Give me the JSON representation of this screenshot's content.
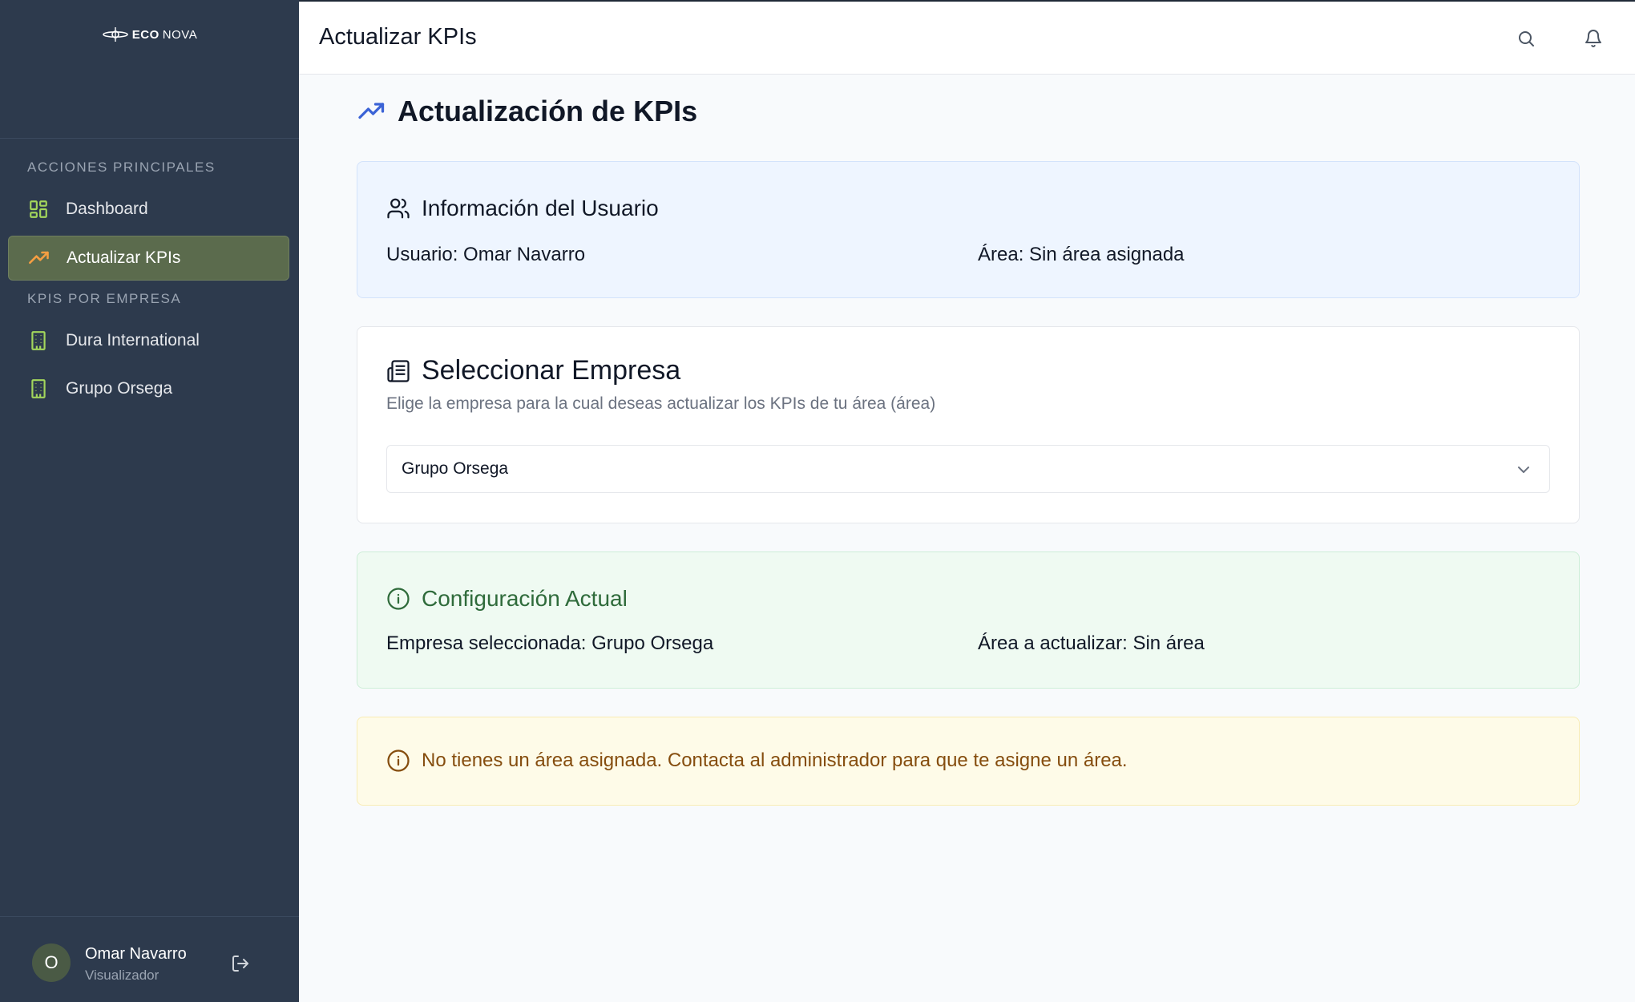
{
  "brand": {
    "logo_eco": "ECO",
    "logo_nova": "NOVA"
  },
  "sidebar": {
    "section_main": "ACCIONES PRINCIPALES",
    "section_kpis": "KPIS POR EMPRESA",
    "items": [
      {
        "label": "Dashboard",
        "icon": "dashboard-grid-icon"
      },
      {
        "label": "Actualizar KPIs",
        "icon": "trending-up-icon",
        "active": true
      },
      {
        "label": "Dura International",
        "icon": "building-icon"
      },
      {
        "label": "Grupo Orsega",
        "icon": "building-icon"
      }
    ],
    "user": {
      "initial": "O",
      "name": "Omar Navarro",
      "role": "Visualizador"
    }
  },
  "header": {
    "title": "Actualizar KPIs"
  },
  "main": {
    "title": "Actualización de KPIs",
    "user_card": {
      "title": "Información del Usuario",
      "user_label": "Usuario:",
      "user_value": "Omar Navarro",
      "area_label": "Área:",
      "area_value": "Sin área asignada"
    },
    "company_card": {
      "title": "Seleccionar Empresa",
      "subtitle": "Elige la empresa para la cual deseas actualizar los KPIs de tu área (área)",
      "selected": "Grupo Orsega"
    },
    "config_card": {
      "title": "Configuración Actual",
      "company_label": "Empresa seleccionada:",
      "company_value": "Grupo Orsega",
      "area_label": "Área a actualizar:",
      "area_value": "Sin área"
    },
    "warning": {
      "text": "No tienes un área asignada. Contacta al administrador para que te asigne un área."
    }
  },
  "colors": {
    "sidebar_bg": "#2d3a4d",
    "active_item_bg": "#5b6b4d",
    "accent_green": "#a3d65c",
    "accent_orange": "#f59e42",
    "accent_blue": "#3b63d6",
    "config_title": "#2f6b3b",
    "warning_text": "#854d0e"
  }
}
